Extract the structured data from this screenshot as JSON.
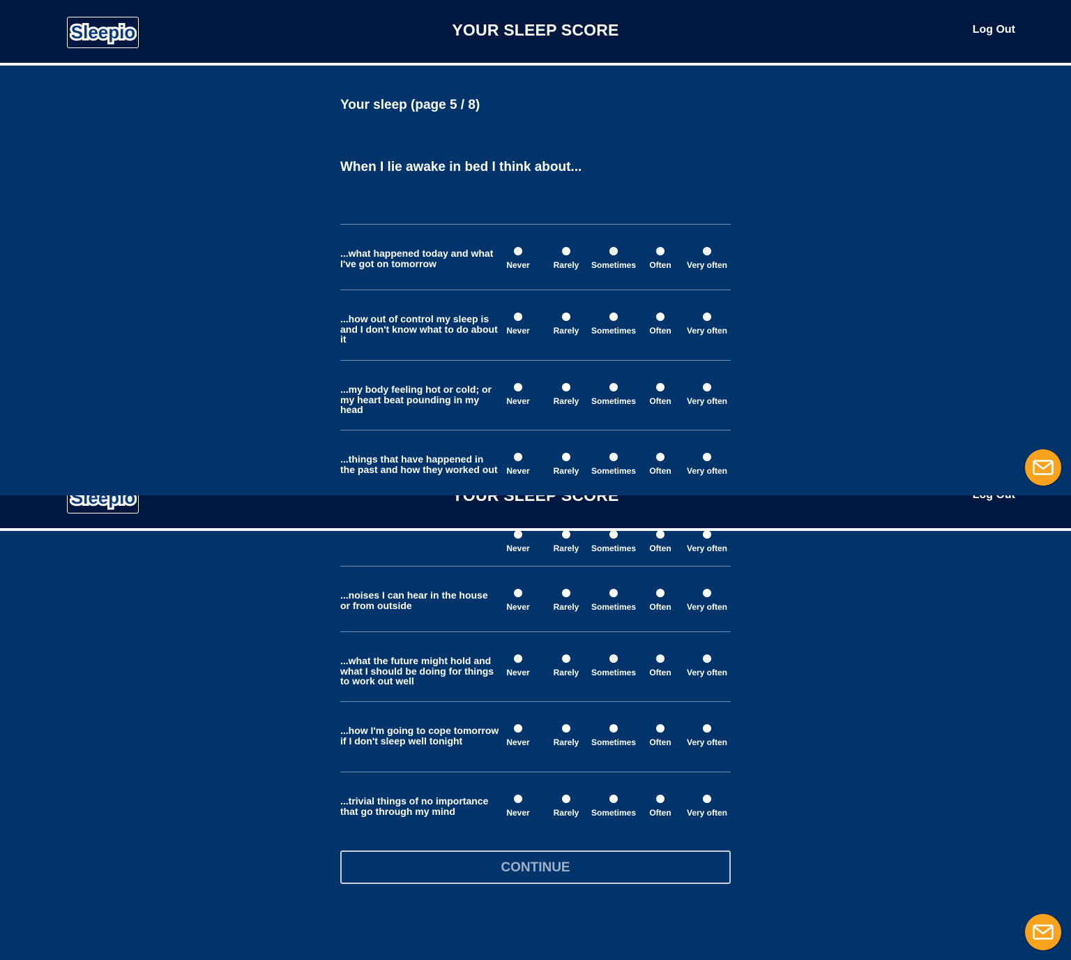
{
  "app": {
    "logo_text": "Sleepio",
    "title": "YOUR SLEEP SCORE",
    "logout_label": "Log Out"
  },
  "survey": {
    "page_label": "Your sleep (page 5 / 8)",
    "question": "When I lie awake in bed I think about...",
    "options": [
      "Never",
      "Rarely",
      "Sometimes",
      "Often",
      "Very often"
    ],
    "items_top": [
      "...what happened today and what I've got on tomorrow",
      "...how out of control my sleep is and I don't know what to do about it",
      "...my body feeling hot or cold; or my heart beat pounding in my head",
      "...things that have happened in the past and how they worked out"
    ],
    "items_bottom": [
      "...noises I can hear in the house or from outside",
      "...what the future might hold and what I should be doing for things to work out well",
      "...how I'm going to cope tomorrow if I don't sleep well tonight",
      "...trivial things of no importance that go through my mind"
    ],
    "continue_label": "CONTINUE"
  },
  "icons": {
    "contact": "mail-icon"
  },
  "colors": {
    "page_bg": "#00346a",
    "header_bg": "#00173f",
    "accent": "#f9a21d"
  }
}
